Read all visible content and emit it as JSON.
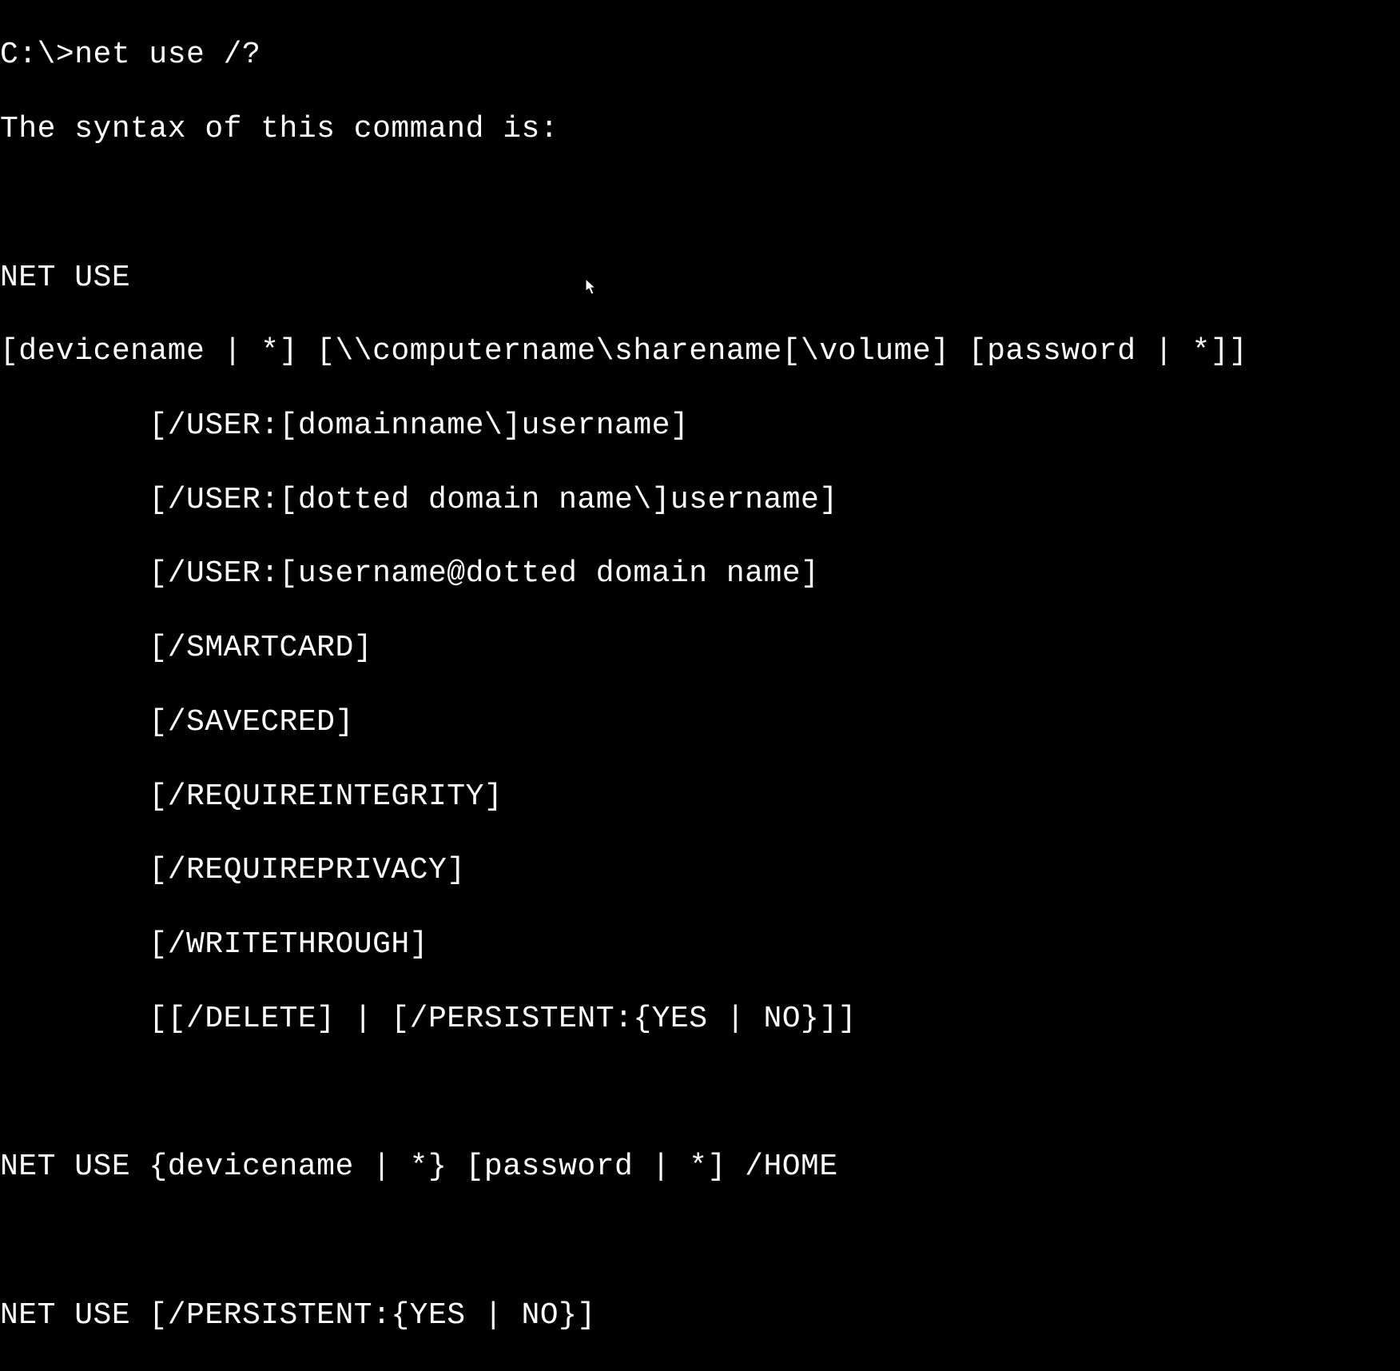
{
  "terminal": {
    "lines": [
      "C:\\>net use /?",
      "The syntax of this command is:",
      "",
      "NET USE",
      "[devicename | *] [\\\\computername\\sharename[\\volume] [password | *]]",
      "        [/USER:[domainname\\]username]",
      "        [/USER:[dotted domain name\\]username]",
      "        [/USER:[username@dotted domain name]",
      "        [/SMARTCARD]",
      "        [/SAVECRED]",
      "        [/REQUIREINTEGRITY]",
      "        [/REQUIREPRIVACY]",
      "        [/WRITETHROUGH]",
      "        [[/DELETE] | [/PERSISTENT:{YES | NO}]]",
      "",
      "NET USE {devicename | *} [password | *] /HOME",
      "",
      "NET USE [/PERSISTENT:{YES | NO}]"
    ]
  }
}
